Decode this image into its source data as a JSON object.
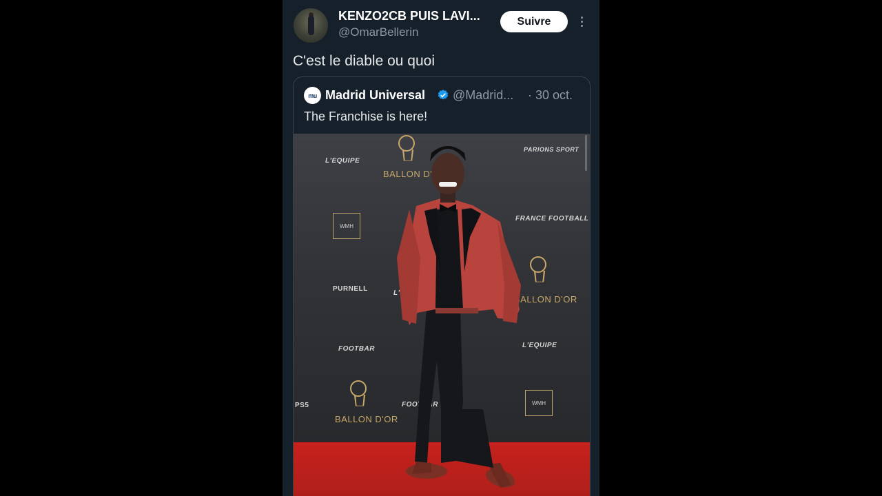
{
  "tweet": {
    "author": {
      "display_name": "KENZO2CB PUIS LAVI...",
      "handle": "@OmarBellerin",
      "avatar_icon": "user-avatar-icon"
    },
    "follow_label": "Suivre",
    "more_icon": "more-options-icon",
    "text": "C'est le diable ou quoi"
  },
  "quoted": {
    "avatar_text": "mu",
    "name": "Madrid Universal",
    "verified_icon": "verified-badge-icon",
    "verified_color": "#1d9bf0",
    "handle": "@Madrid...",
    "date": "· 30 oct.",
    "text": "The Franchise is here!",
    "photo": {
      "backdrop_logos": {
        "lequipe": "L'EQUIPE",
        "ballon_dor": "BALLON D'OR",
        "wmh": "WMH",
        "parions_sport": "PARIONS SPORT",
        "france_football": "FRANCE FOOTBALL",
        "purnell": "PURNELL",
        "footbar": "FOOTBAR",
        "ps5": "PS5"
      }
    }
  },
  "colors": {
    "background": "#15202b",
    "muted_text": "#8b98a5",
    "border": "#38444d",
    "carpet": "#c7211c",
    "gold": "#c8a868"
  }
}
